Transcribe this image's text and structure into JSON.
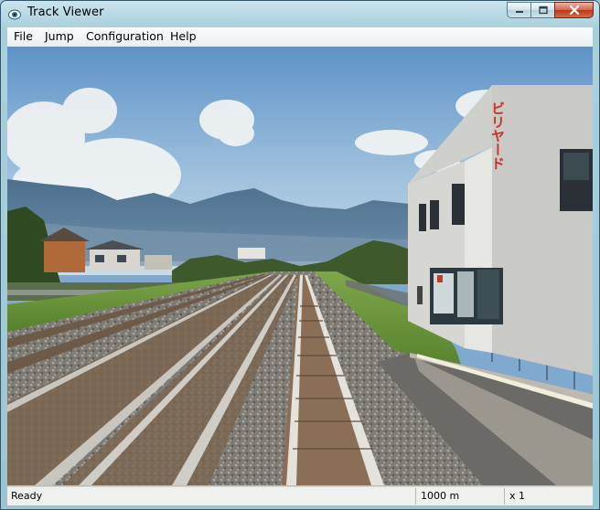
{
  "window": {
    "title": "Track Viewer"
  },
  "menu": {
    "items": [
      {
        "label": "File"
      },
      {
        "label": "Jump"
      },
      {
        "label": "Configuration"
      },
      {
        "label": "Help"
      }
    ]
  },
  "scene": {
    "signage_text": "ビリヤード",
    "colors": {
      "sky": "#86aed4",
      "grass": "#6f9a3c",
      "ballast": "#8a8884",
      "building": "#dcdcd8"
    }
  },
  "status": {
    "state": "Ready",
    "distance": "1000 m",
    "speed": "x 1"
  },
  "icons": {
    "app": "eye-icon",
    "minimize": "minimize-icon",
    "maximize": "maximize-icon",
    "close": "close-icon"
  }
}
